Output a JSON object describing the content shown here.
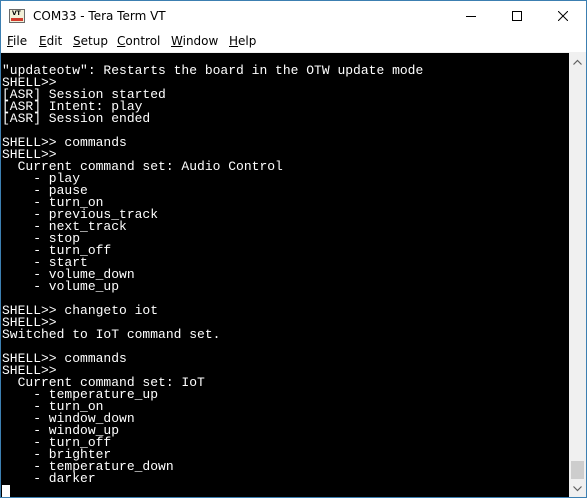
{
  "window": {
    "title": "COM33 - Tera Term VT",
    "app_icon_text": "VT",
    "icons": {
      "app": "tera-term-icon",
      "minimize": "minimize-icon",
      "maximize": "maximize-icon",
      "close": "close-icon",
      "scroll_up": "chevron-up-icon",
      "scroll_down": "chevron-down-icon"
    }
  },
  "menu": [
    {
      "key": "F",
      "rest": "ile"
    },
    {
      "key": "E",
      "rest": "dit"
    },
    {
      "key": "S",
      "rest": "etup"
    },
    {
      "key": "C",
      "rest": "ontrol"
    },
    {
      "key": "W",
      "rest": "indow"
    },
    {
      "key": "H",
      "rest": "elp"
    }
  ],
  "terminal": {
    "background": "#000000",
    "foreground": "#ffffff",
    "lines": [
      "\"updateotw\": Restarts the board in the OTW update mode",
      "SHELL>>",
      "[ASR] Session started",
      "[ASR] Intent: play",
      "[ASR] Session ended",
      "",
      "SHELL>> commands",
      "SHELL>>",
      "  Current command set: Audio Control",
      "    - play",
      "    - pause",
      "    - turn_on",
      "    - previous_track",
      "    - next_track",
      "    - stop",
      "    - turn_off",
      "    - start",
      "    - volume_down",
      "    - volume_up",
      "",
      "SHELL>> changeto iot",
      "SHELL>>",
      "Switched to IoT command set.",
      "",
      "SHELL>> commands",
      "SHELL>>",
      "  Current command set: IoT",
      "    - temperature_up",
      "    - turn_on",
      "    - window_down",
      "    - window_up",
      "    - turn_off",
      "    - brighter",
      "    - temperature_down",
      "    - darker"
    ]
  }
}
